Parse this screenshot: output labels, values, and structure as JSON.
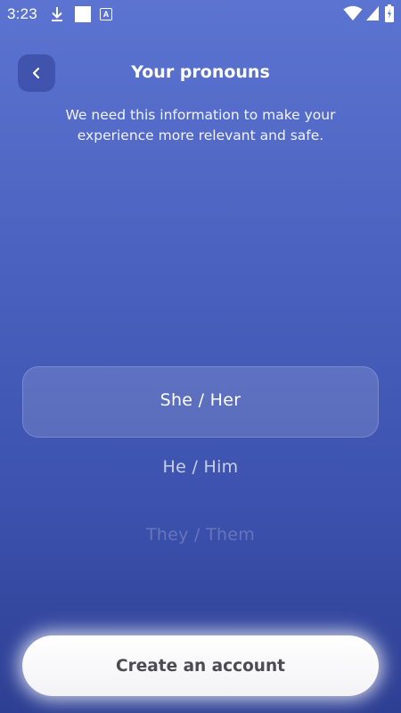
{
  "status_bar": {
    "time": "3:23",
    "icons": [
      "download-icon",
      "square-icon",
      "a-badge-icon",
      "wifi-icon",
      "signal-icon",
      "battery-icon"
    ],
    "a_badge_letter": "A"
  },
  "header": {
    "title": "Your pronouns",
    "back_icon": "chevron-left-icon"
  },
  "subtitle": "We need this information to make your experience more relevant and safe.",
  "picker": {
    "selected_index": 0,
    "options": [
      "She / Her",
      "He / Him",
      "They / Them"
    ]
  },
  "cta": {
    "label": "Create an account"
  },
  "colors": {
    "background_top": "#5C74D1",
    "background_bottom": "#2E3F93",
    "back_button_bg": "#2D3E96",
    "cta_bg": "#FFFFFF",
    "cta_text": "#4B4B50",
    "text_primary": "#FFFFFF"
  }
}
